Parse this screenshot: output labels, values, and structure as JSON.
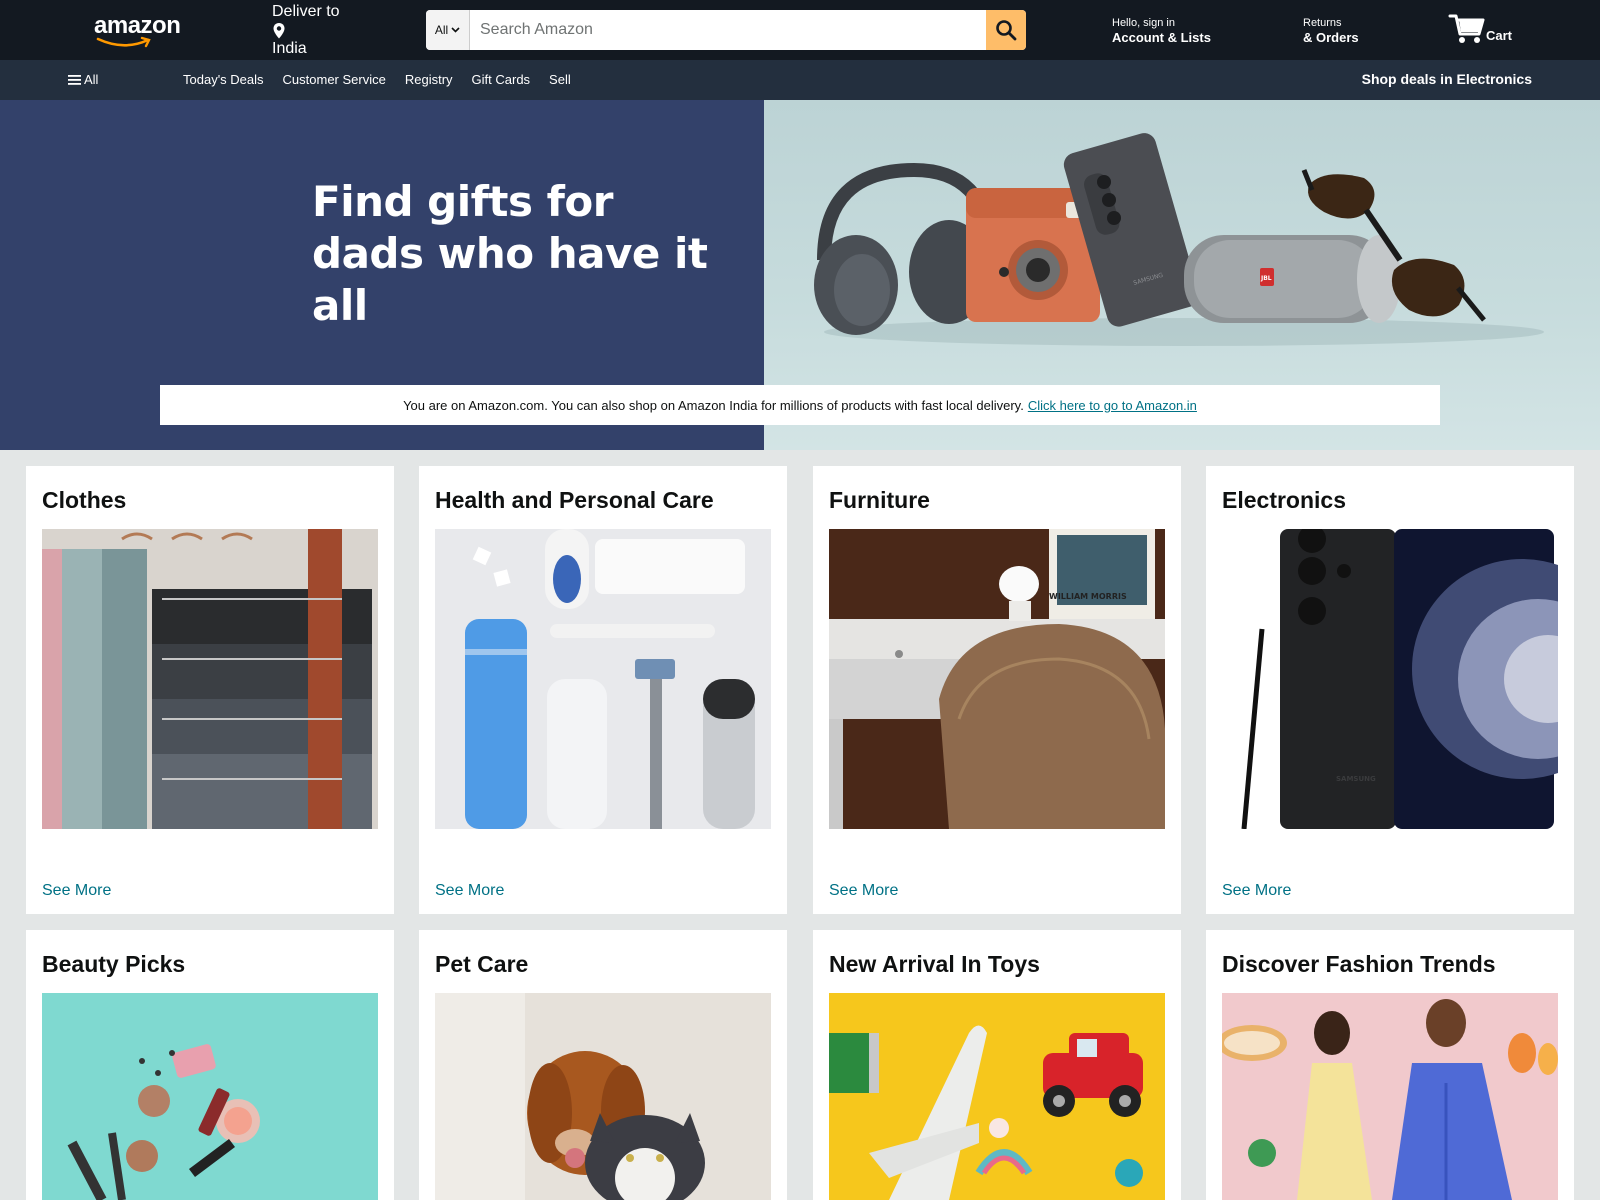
{
  "header": {
    "logo": "amazon",
    "deliver_label": "Deliver to",
    "deliver_country": "India",
    "search_dept": "All",
    "search_placeholder": "Search Amazon",
    "account_line1": "Hello, sign in",
    "account_line2": "Account & Lists",
    "returns_line1": "Returns",
    "returns_line2": "& Orders",
    "cart_label": "Cart"
  },
  "subnav": {
    "all_label": "All",
    "links": [
      "Today's Deals",
      "Customer Service",
      "Registry",
      "Gift Cards",
      "Sell"
    ],
    "promo": "Shop deals in Electronics"
  },
  "hero": {
    "headline_line1": "Find gifts for",
    "headline_line2": "dads who have it all",
    "notice_text": "You are on Amazon.com. You can also shop on Amazon India for millions of products with fast local delivery.",
    "notice_link": "Click here to go to Amazon.in"
  },
  "cards": [
    {
      "title": "Clothes",
      "link": "See More"
    },
    {
      "title": "Health and Personal Care",
      "link": "See More"
    },
    {
      "title": "Furniture",
      "link": "See More"
    },
    {
      "title": "Electronics",
      "link": "See More"
    },
    {
      "title": "Beauty Picks"
    },
    {
      "title": "Pet Care"
    },
    {
      "title": "New Arrival In Toys"
    },
    {
      "title": "Discover Fashion Trends"
    }
  ],
  "colors": {
    "header_bg": "#131921",
    "subnav_bg": "#232f3e",
    "search_button": "#febd69",
    "hero_left_bg": "#33416a",
    "link": "#007185",
    "page_bg": "#e3e6e6"
  },
  "icons": [
    "location-pin-icon",
    "search-icon",
    "cart-icon",
    "hamburger-menu-icon",
    "chevron-down-icon"
  ],
  "images": {
    "hero_words": [
      "SAMSUNG",
      "JBL"
    ],
    "furniture_print": "WILLIAM MORRIS",
    "electronics_brand": "SAMSUNG"
  }
}
